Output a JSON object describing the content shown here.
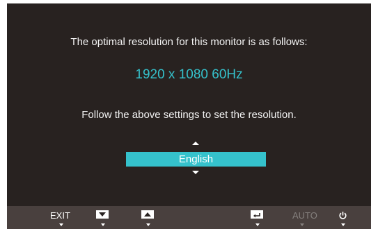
{
  "message": {
    "line1": "The optimal resolution for this monitor is as follows:",
    "resolution": "1920 x 1080  60Hz",
    "line2": "Follow the above settings to set the resolution."
  },
  "language_selector": {
    "selected": "English"
  },
  "bottom_bar": {
    "exit_label": "EXIT",
    "down_button": "down-arrow-icon",
    "up_button": "up-arrow-icon",
    "enter_button": "enter-icon",
    "auto_label": "AUTO",
    "power_button": "power-icon"
  },
  "colors": {
    "background": "#282220",
    "accent": "#35c2cc",
    "bottom_bar": "#49403e",
    "dim_text": "#85807e"
  }
}
